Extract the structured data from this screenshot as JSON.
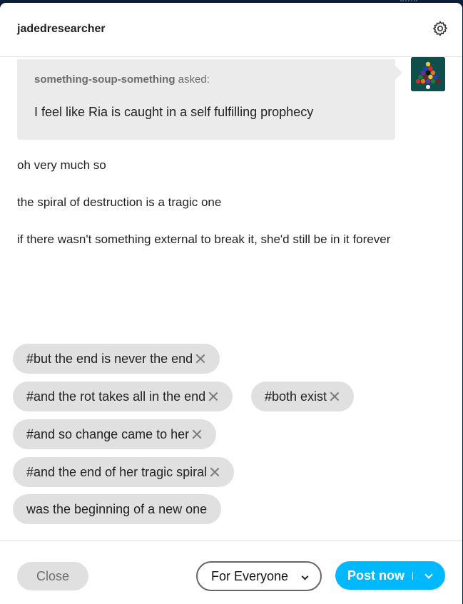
{
  "header": {
    "blog_name": "jadedresearcher",
    "settings_icon": "gear-icon"
  },
  "ask": {
    "asker": "something-soup-something",
    "asked_label": "asked:",
    "question": "I feel like Ria is caught in a self fulfilling prophecy"
  },
  "answer": {
    "paragraphs": [
      "oh very much so",
      "the spiral of destruction is a tragic one",
      "if there wasn't something external to break it, she'd still be in it forever"
    ]
  },
  "tags": [
    "#but the end is never the end",
    "#and the rot takes all in the end",
    "#both exist",
    "#and so change came to her",
    "#and the end of her tragic spiral",
    "was the beginning of a new one"
  ],
  "footer": {
    "close_label": "Close",
    "audience_label": "For Everyone",
    "post_label": "Post now"
  },
  "colors": {
    "accent": "#00b8ff",
    "backdrop": "#001935",
    "tag_bg": "#e0e0e0",
    "ask_bg": "#ebebeb"
  }
}
